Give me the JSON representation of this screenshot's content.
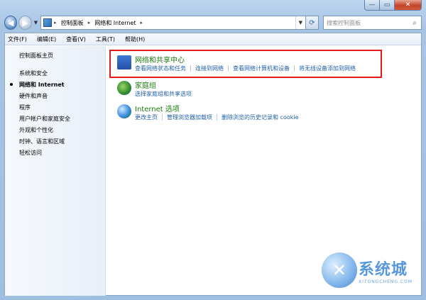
{
  "window": {
    "caption": {
      "minimize": "—",
      "maximize": "▭",
      "close": "✕"
    }
  },
  "nav": {
    "back_glyph": "◀",
    "forward_glyph": "▶",
    "breadcrumbs": [
      "控制面板",
      "网络和 Internet"
    ],
    "crumb_separator": "▸",
    "search_placeholder": "搜索控制面板"
  },
  "menubar": {
    "items": [
      "文件(F)",
      "编辑(E)",
      "查看(V)",
      "工具(T)",
      "帮助(H)"
    ]
  },
  "sidebar": {
    "home": "控制面板主页",
    "items": [
      "系统和安全",
      "网络和 Internet",
      "硬件和声音",
      "程序",
      "用户帐户和家庭安全",
      "外观和个性化",
      "时钟、语言和区域",
      "轻松访问"
    ],
    "current_index": 1
  },
  "categories": [
    {
      "title": "网络和共享中心",
      "icon": "network-icon",
      "links": [
        "查看网络状态和任务",
        "连接到网络",
        "查看网络计算机和设备",
        "将无线设备添加到网络"
      ]
    },
    {
      "title": "家庭组",
      "icon": "homegroup-icon",
      "links": [
        "选择家庭组和共享选项"
      ]
    },
    {
      "title": "Internet 选项",
      "icon": "internet-options-icon",
      "links": [
        "更改主页",
        "管理浏览器加载项",
        "删除浏览的历史记录和 cookie"
      ]
    }
  ],
  "colors": {
    "category_title": "#1b7a10",
    "link": "#1f5fa8",
    "highlight_border": "#e21a1a"
  },
  "watermark": {
    "big": "系统城",
    "small": "XITONGCHENG.COM",
    "glyph": "✕"
  }
}
